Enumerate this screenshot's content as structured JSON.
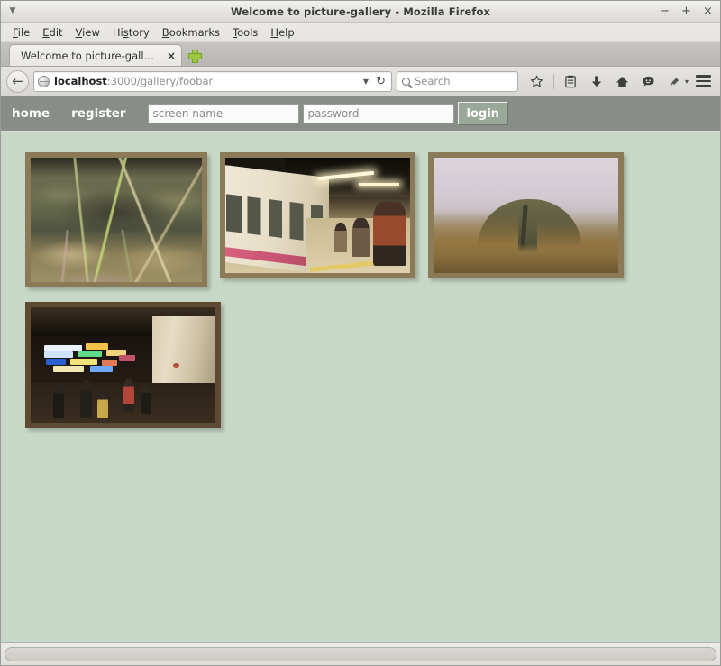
{
  "window": {
    "title": "Welcome to picture-gallery - Mozilla Firefox",
    "menu_arrow": "▼",
    "minimize": "−",
    "maximize": "+",
    "close": "×"
  },
  "menubar": {
    "items": [
      {
        "label": "File",
        "mnemonic": "F",
        "rest": "ile"
      },
      {
        "label": "Edit",
        "mnemonic": "E",
        "rest": "dit"
      },
      {
        "label": "View",
        "mnemonic": "V",
        "rest": "iew"
      },
      {
        "label": "History",
        "mnemonic": "s",
        "pre": "Hi",
        "rest": "tory"
      },
      {
        "label": "Bookmarks",
        "mnemonic": "B",
        "rest": "ookmarks"
      },
      {
        "label": "Tools",
        "mnemonic": "T",
        "rest": "ools"
      },
      {
        "label": "Help",
        "mnemonic": "H",
        "rest": "elp"
      }
    ]
  },
  "tabs": {
    "active": {
      "title": "Welcome to picture-gallery",
      "close": "×"
    },
    "new_tab_icon": "plus-icon"
  },
  "toolbar": {
    "back_icon": "←",
    "url_host": "localhost",
    "url_path": ":3000/gallery/foobar",
    "url_full": "localhost:3000/gallery/foobar",
    "url_dropdown_icon": "▼",
    "reload_icon": "↻",
    "search_placeholder": "Search",
    "icons": [
      {
        "name": "bookmark-star-icon",
        "glyph": "☆"
      },
      {
        "name": "library-icon",
        "glyph": "Ὅ1"
      },
      {
        "name": "download-icon",
        "glyph": "↓"
      },
      {
        "name": "home-icon",
        "glyph": "⌂"
      },
      {
        "name": "chat-icon",
        "glyph": "☺"
      },
      {
        "name": "pin-icon",
        "glyph": "✎"
      }
    ],
    "menu_caret": "▾"
  },
  "page": {
    "nav": {
      "links": [
        {
          "label": "home"
        },
        {
          "label": "register"
        }
      ],
      "screen_name_placeholder": "screen name",
      "screen_name_value": "",
      "password_placeholder": "password",
      "password_value": "",
      "login_label": "login"
    },
    "gallery": {
      "photos": [
        {
          "alt": "mossy-rock-with-grass",
          "frame": "tan"
        },
        {
          "alt": "train-station-platform",
          "frame": "tan"
        },
        {
          "alt": "foggy-mountain-ridge",
          "frame": "tan"
        },
        {
          "alt": "night-city-street-neon",
          "frame": "dark"
        }
      ]
    },
    "colors": {
      "background": "#c8d8c8",
      "nav_bar": "#888e87",
      "login_button": "#9aa89a",
      "frame_tan": "#8b7a58",
      "frame_dark": "#5e4a32"
    }
  }
}
